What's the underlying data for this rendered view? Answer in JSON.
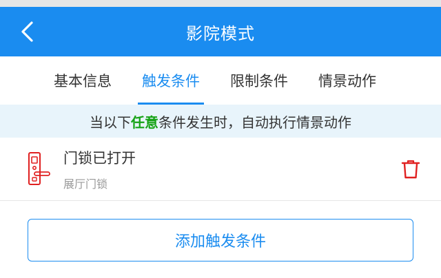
{
  "header": {
    "title": "影院模式",
    "back_icon": "chevron-left-icon"
  },
  "tabs": [
    {
      "label": "基本信息",
      "active": false
    },
    {
      "label": "触发条件",
      "active": true
    },
    {
      "label": "限制条件",
      "active": false
    },
    {
      "label": "情景动作",
      "active": false
    }
  ],
  "notice": {
    "prefix": "当以下",
    "highlight": "任意",
    "suffix": "条件发生时，自动执行情景动作"
  },
  "conditions": [
    {
      "name": "门锁已打开",
      "location": "展厅门锁",
      "icon": "door-lock-icon"
    }
  ],
  "add_button": {
    "label": "添加触发条件"
  },
  "colors": {
    "primary": "#1a8cf0",
    "highlight": "#17a317",
    "delete": "#e02020",
    "notice_bg": "#e8f4fb"
  }
}
